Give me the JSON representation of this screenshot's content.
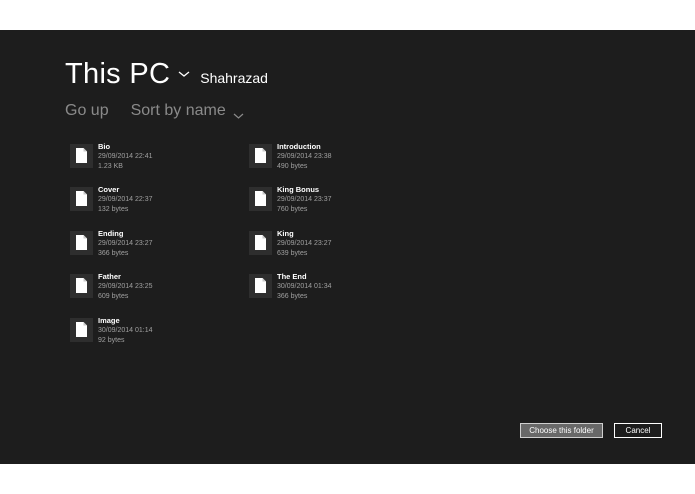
{
  "header": {
    "location": "This PC",
    "subfolder": "Shahrazad"
  },
  "commands": {
    "go_up": "Go up",
    "sort": "Sort by name"
  },
  "files": [
    {
      "name": "Bio",
      "date": "29/09/2014 22:41",
      "size": "1.23 KB"
    },
    {
      "name": "Cover",
      "date": "29/09/2014 22:37",
      "size": "132 bytes"
    },
    {
      "name": "Ending",
      "date": "29/09/2014 23:27",
      "size": "366 bytes"
    },
    {
      "name": "Father",
      "date": "29/09/2014 23:25",
      "size": "609 bytes"
    },
    {
      "name": "Image",
      "date": "30/09/2014 01:14",
      "size": "92 bytes"
    },
    {
      "name": "Introduction",
      "date": "29/09/2014 23:38",
      "size": "490 bytes"
    },
    {
      "name": "King Bonus",
      "date": "29/09/2014 23:37",
      "size": "760 bytes"
    },
    {
      "name": "King",
      "date": "29/09/2014 23:27",
      "size": "639 bytes"
    },
    {
      "name": "The End",
      "date": "30/09/2014 01:34",
      "size": "366 bytes"
    }
  ],
  "buttons": {
    "choose": "Choose this folder",
    "cancel": "Cancel"
  },
  "icons": {
    "file": "document-icon",
    "location_chevron": "chevron-down-icon",
    "sort_chevron": "chevron-down-icon"
  },
  "colors": {
    "background": "#1d1d1d",
    "tile": "#2e2e2e",
    "muted_text": "#8a8a8a"
  }
}
